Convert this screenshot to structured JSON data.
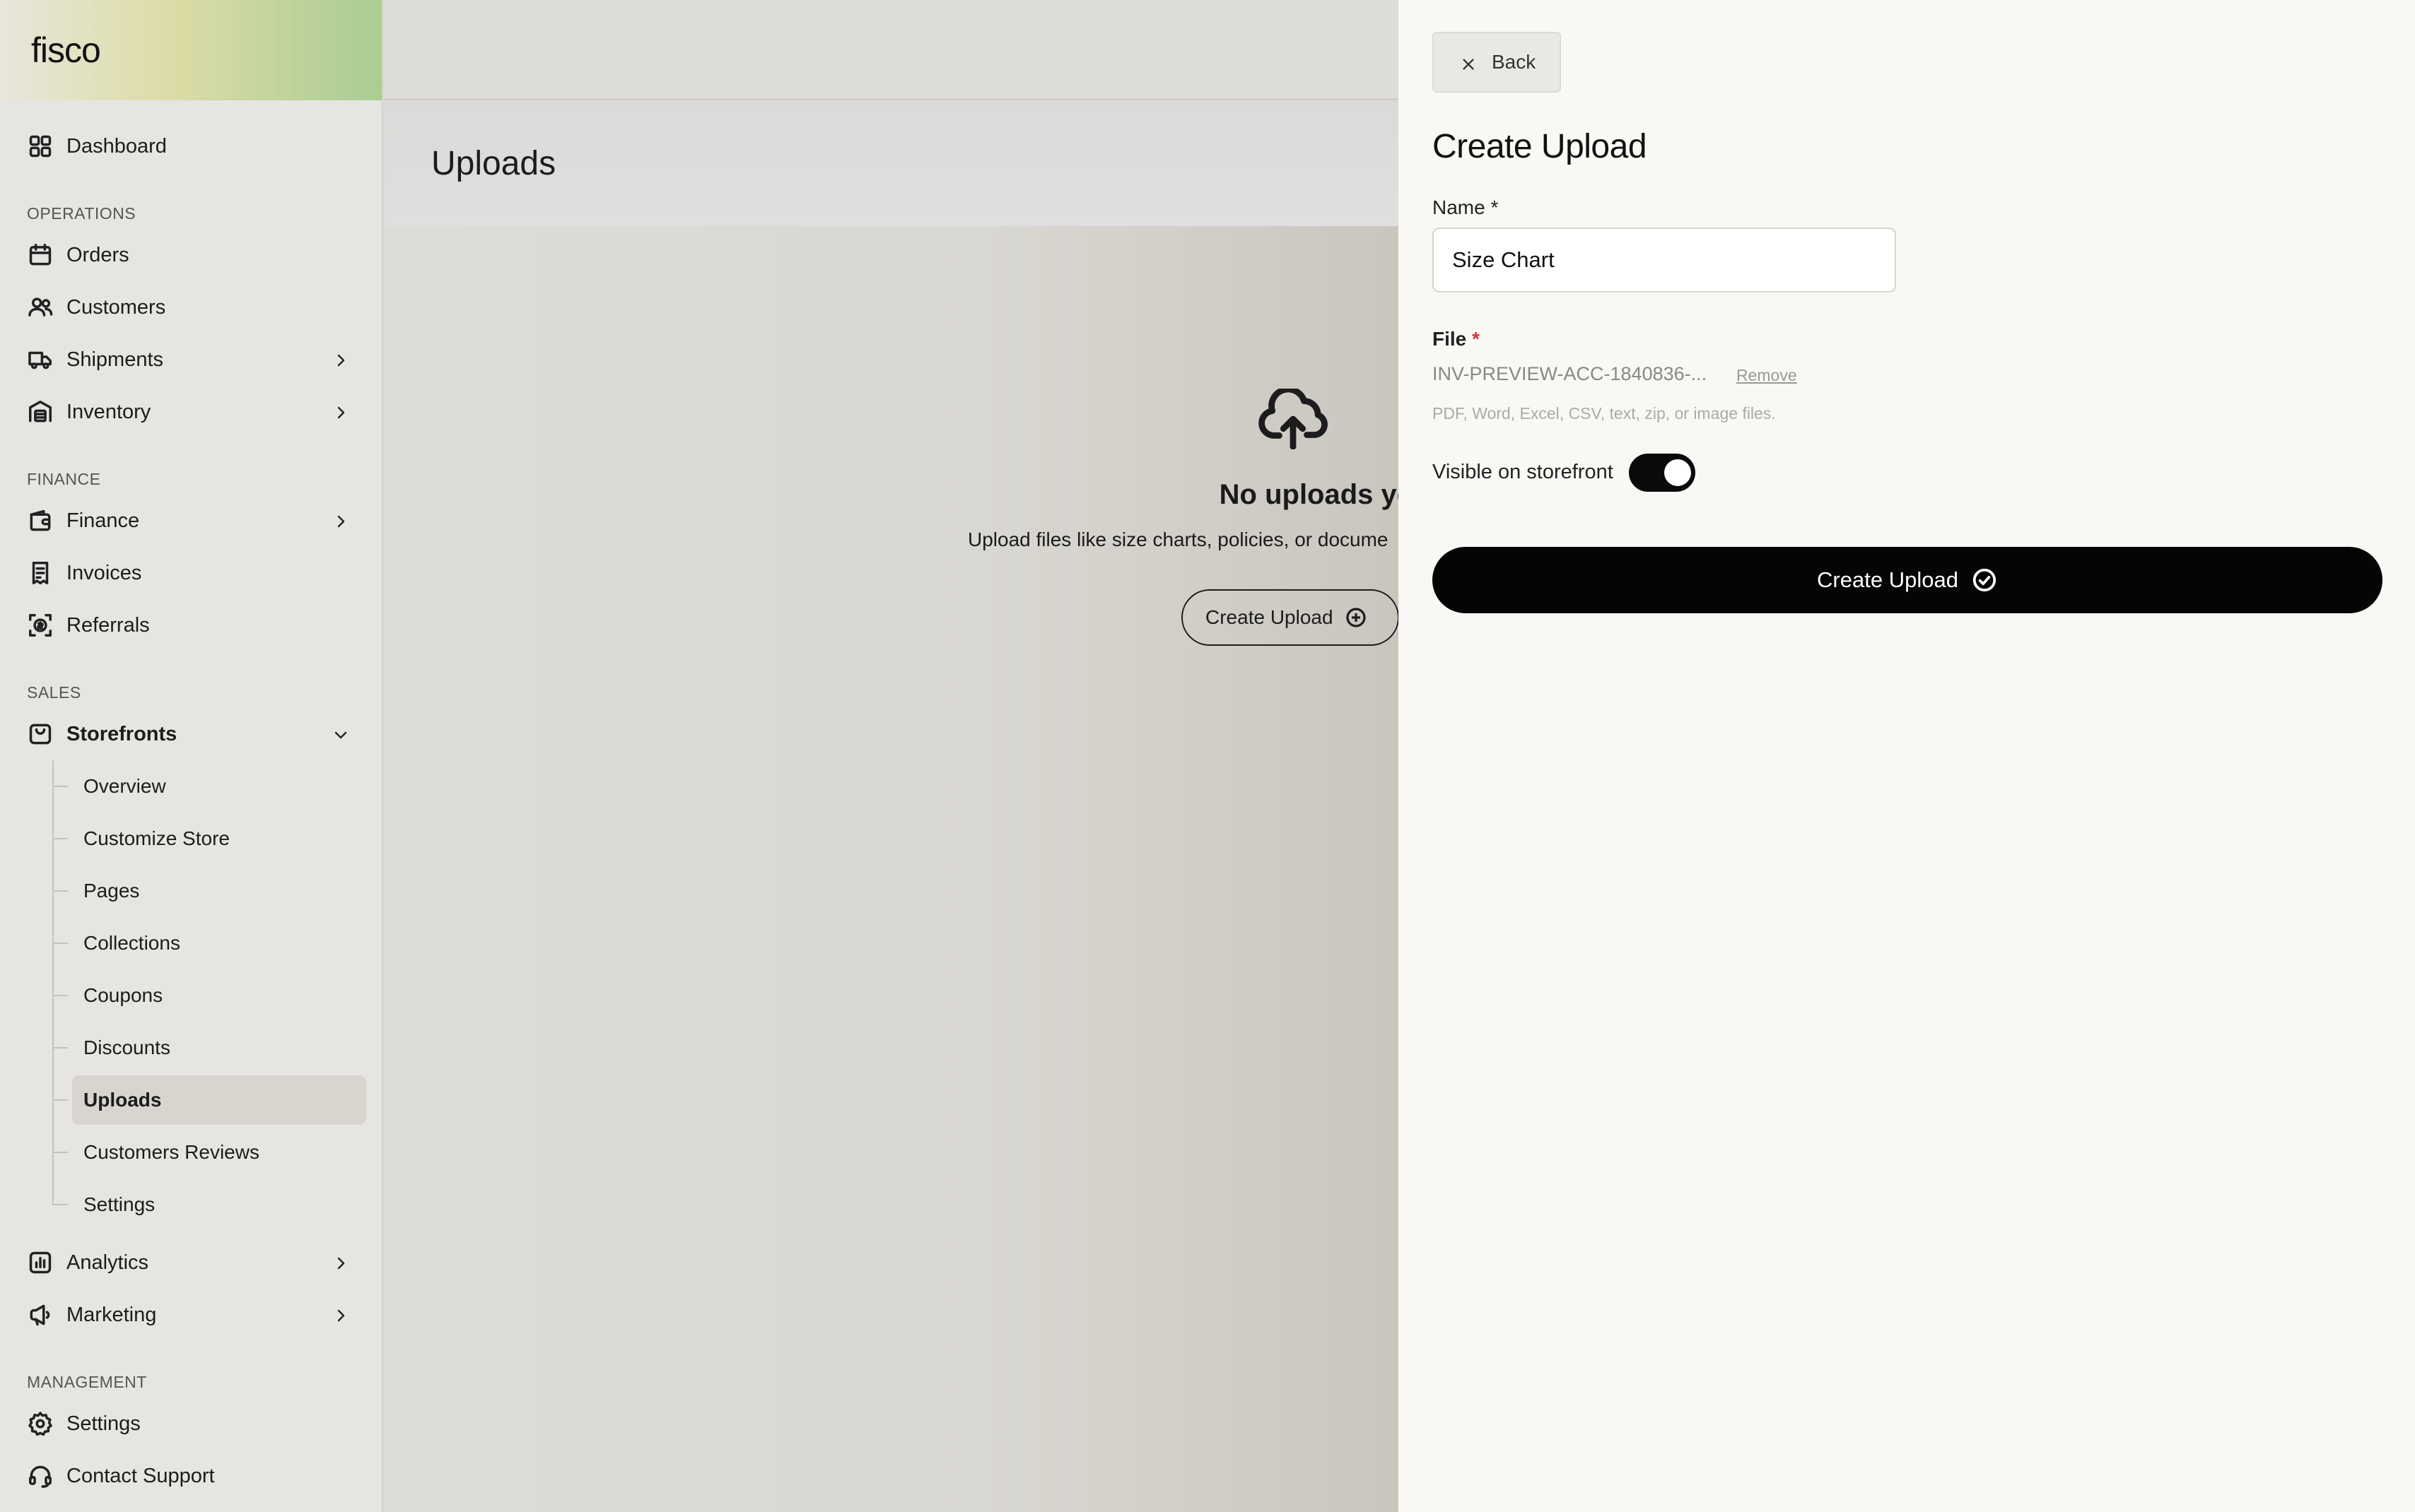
{
  "brand": "fisco",
  "sidebar": {
    "top": [
      {
        "label": "Dashboard",
        "icon": "dashboard-grid-icon"
      }
    ],
    "sections": [
      {
        "label": "OPERATIONS",
        "items": [
          {
            "label": "Orders",
            "icon": "orders-box-icon",
            "chevron": false
          },
          {
            "label": "Customers",
            "icon": "customers-people-icon",
            "chevron": false
          },
          {
            "label": "Shipments",
            "icon": "truck-icon",
            "chevron": true
          },
          {
            "label": "Inventory",
            "icon": "warehouse-icon",
            "chevron": true
          }
        ]
      },
      {
        "label": "FINANCE",
        "items": [
          {
            "label": "Finance",
            "icon": "wallet-icon",
            "chevron": true
          },
          {
            "label": "Invoices",
            "icon": "receipt-icon",
            "chevron": false
          },
          {
            "label": "Referrals",
            "icon": "referral-dollar-icon",
            "chevron": false
          }
        ]
      },
      {
        "label": "SALES"
      },
      {
        "label": "MANAGEMENT"
      }
    ],
    "storefronts": {
      "label": "Storefronts",
      "icon": "shopping-bag-icon",
      "children": [
        "Overview",
        "Customize Store",
        "Pages",
        "Collections",
        "Coupons",
        "Discounts",
        "Uploads",
        "Customers Reviews",
        "Settings"
      ],
      "active": "Uploads"
    },
    "after_sales": [
      {
        "label": "Analytics",
        "icon": "analytics-chart-icon",
        "chevron": true
      },
      {
        "label": "Marketing",
        "icon": "megaphone-icon",
        "chevron": true
      }
    ],
    "management": [
      {
        "label": "Settings",
        "icon": "gear-icon"
      },
      {
        "label": "Contact Support",
        "icon": "headset-icon"
      }
    ]
  },
  "main": {
    "page_title": "Uploads",
    "empty_state": {
      "icon": "cloud-upload-icon",
      "title": "No uploads yet",
      "description": "Upload files like size charts, policies, or docume",
      "button_label": "Create Upload"
    }
  },
  "drawer": {
    "back_label": "Back",
    "title": "Create Upload",
    "name_label": "Name",
    "name_value": "Size Chart",
    "file_label": "File",
    "required_mark": "*",
    "file_name": "INV-PREVIEW-ACC-1840836-...",
    "remove_label": "Remove",
    "file_hint": "PDF, Word, Excel, CSV, text, zip, or image files.",
    "visible_label": "Visible on storefront",
    "visible_on": true,
    "submit_label": "Create Upload"
  },
  "colors": {
    "primary_button": "#050505",
    "required": "#d03b2f",
    "sidebar_bg": "#e6e5e2",
    "drawer_bg": "#f9f8f5"
  }
}
